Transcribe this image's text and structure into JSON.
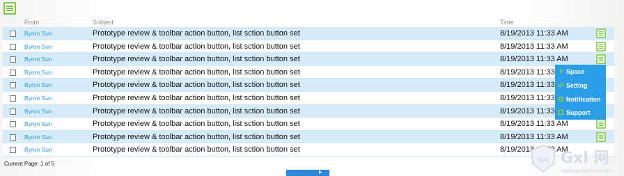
{
  "toolbar": {
    "menu_icon": "list-menu-icon",
    "accent": "#7ec84a"
  },
  "columns": {
    "from": "From",
    "subject": "Subject",
    "time": "Time"
  },
  "rows": [
    {
      "from": "Byron Sun",
      "subject": "Prototype review & toolbar action button, list sction button set",
      "time": "8/19/2013 11:33 AM"
    },
    {
      "from": "Byron Sun",
      "subject": "Prototype review & toolbar action button, list sction button set",
      "time": "8/19/2013 11:33 AM"
    },
    {
      "from": "Byron Sun",
      "subject": "Prototype review & toolbar action button, list sction button set",
      "time": "8/19/2013 11:33 AM"
    },
    {
      "from": "Byron Sun",
      "subject": "Prototype review & toolbar action button, list sction button set",
      "time": "8/19/2013 11:33 AM"
    },
    {
      "from": "Byron Sun",
      "subject": "Prototype review & toolbar action button, list sction button set",
      "time": "8/19/2013 11:33 AM"
    },
    {
      "from": "Byron Sun",
      "subject": "Prototype review & toolbar action button, list sction button set",
      "time": "8/19/2013 11:33 AM"
    },
    {
      "from": "Byron Sun",
      "subject": "Prototype review & toolbar action button, list sction button set",
      "time": "8/19/2013 11:33 AM"
    },
    {
      "from": "Byron Sun",
      "subject": "Prototype review & toolbar action button, list sction button set",
      "time": "8/19/2013 11:33 AM"
    },
    {
      "from": "Byron Sun",
      "subject": "Prototype review & toolbar action button, list sction button set",
      "time": "8/19/2013 11:33 AM"
    },
    {
      "from": "Byron Sun",
      "subject": "Prototype review & toolbar action button, list sction button set",
      "time": "8/19/2013 11:33 AM"
    }
  ],
  "flyout": {
    "color": "#2c9ee9",
    "items": [
      {
        "label": "Space",
        "icon": "space-icon"
      },
      {
        "label": "Setting",
        "icon": "link-icon"
      },
      {
        "label": "Notification",
        "icon": "globe-icon"
      },
      {
        "label": "Support",
        "icon": "support-icon"
      }
    ]
  },
  "pager": {
    "status": "Current Page: 1 of 5"
  },
  "watermark": {
    "brand": "Gxl 网",
    "url": "www.gxlsystem.com"
  }
}
